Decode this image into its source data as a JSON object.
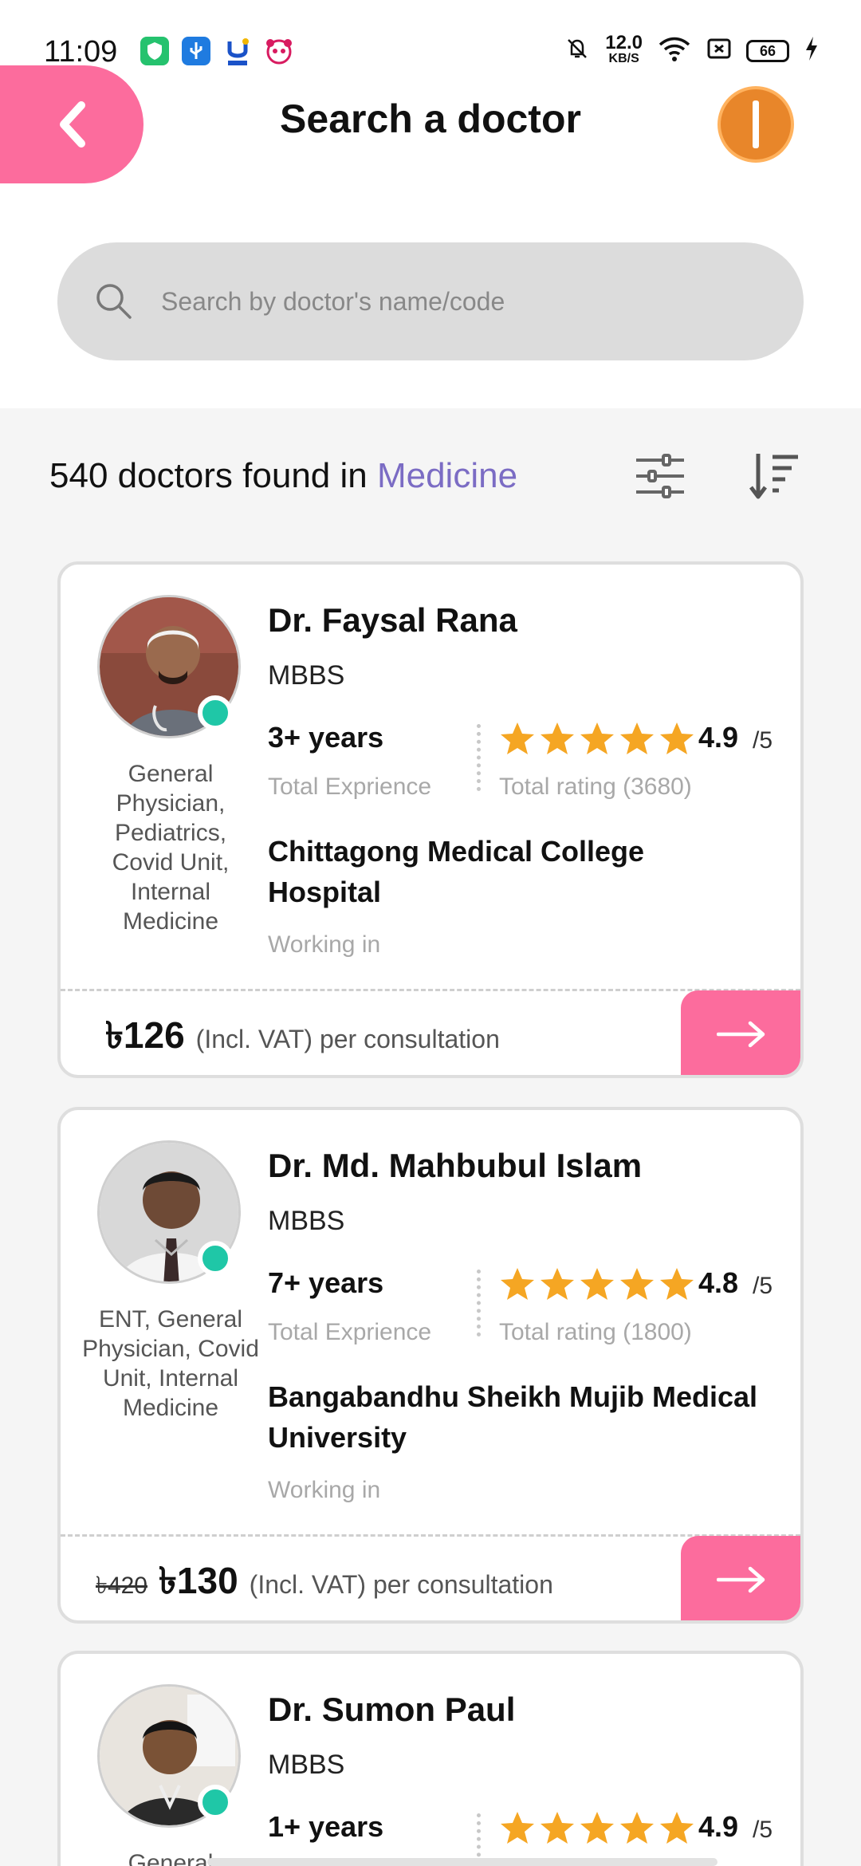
{
  "status_bar": {
    "time": "11:09",
    "speed_value": "12.0",
    "speed_unit": "KB/S",
    "battery": "66",
    "app_icons": [
      "shield-icon",
      "usb-icon",
      "upay-icon",
      "panda-icon"
    ]
  },
  "header": {
    "title": "Search a doctor"
  },
  "search": {
    "placeholder": "Search by doctor's name/code"
  },
  "results": {
    "count_text": "540 doctors found in ",
    "category": "Medicine"
  },
  "labels": {
    "experience": "Total Exprience",
    "working_in": "Working in",
    "vat": "(Incl. VAT) per consultation",
    "rating_max": "/5"
  },
  "doctors": [
    {
      "name": "Dr. Faysal Rana",
      "degree": "MBBS",
      "experience": "3+ years",
      "rating": "4.9",
      "rating_label": "Total rating (3680)",
      "specialties": "General Physician, Pediatrics, Covid Unit, Internal Medicine",
      "hospital": "Chittagong Medical College Hospital",
      "old_price": "",
      "price": "৳126"
    },
    {
      "name": "Dr. Md. Mahbubul Islam",
      "degree": "MBBS",
      "experience": "7+ years",
      "rating": "4.8",
      "rating_label": "Total rating (1800)",
      "specialties": "ENT, General Physician, Covid Unit, Internal Medicine",
      "hospital": "Bangabandhu Sheikh Mujib Medical University",
      "old_price": "৳420",
      "price": "৳130"
    },
    {
      "name": "Dr. Sumon Paul",
      "degree": "MBBS",
      "experience": "1+ years",
      "rating": "4.9",
      "rating_label": "",
      "specialties": "General",
      "hospital": "",
      "old_price": "",
      "price": ""
    }
  ],
  "colors": {
    "accent_pink": "#fc6c9d",
    "category_purple": "#7b6cc4",
    "star": "#f5a623",
    "online": "#1fc7a7",
    "avatar_orange": "#e8862a"
  }
}
